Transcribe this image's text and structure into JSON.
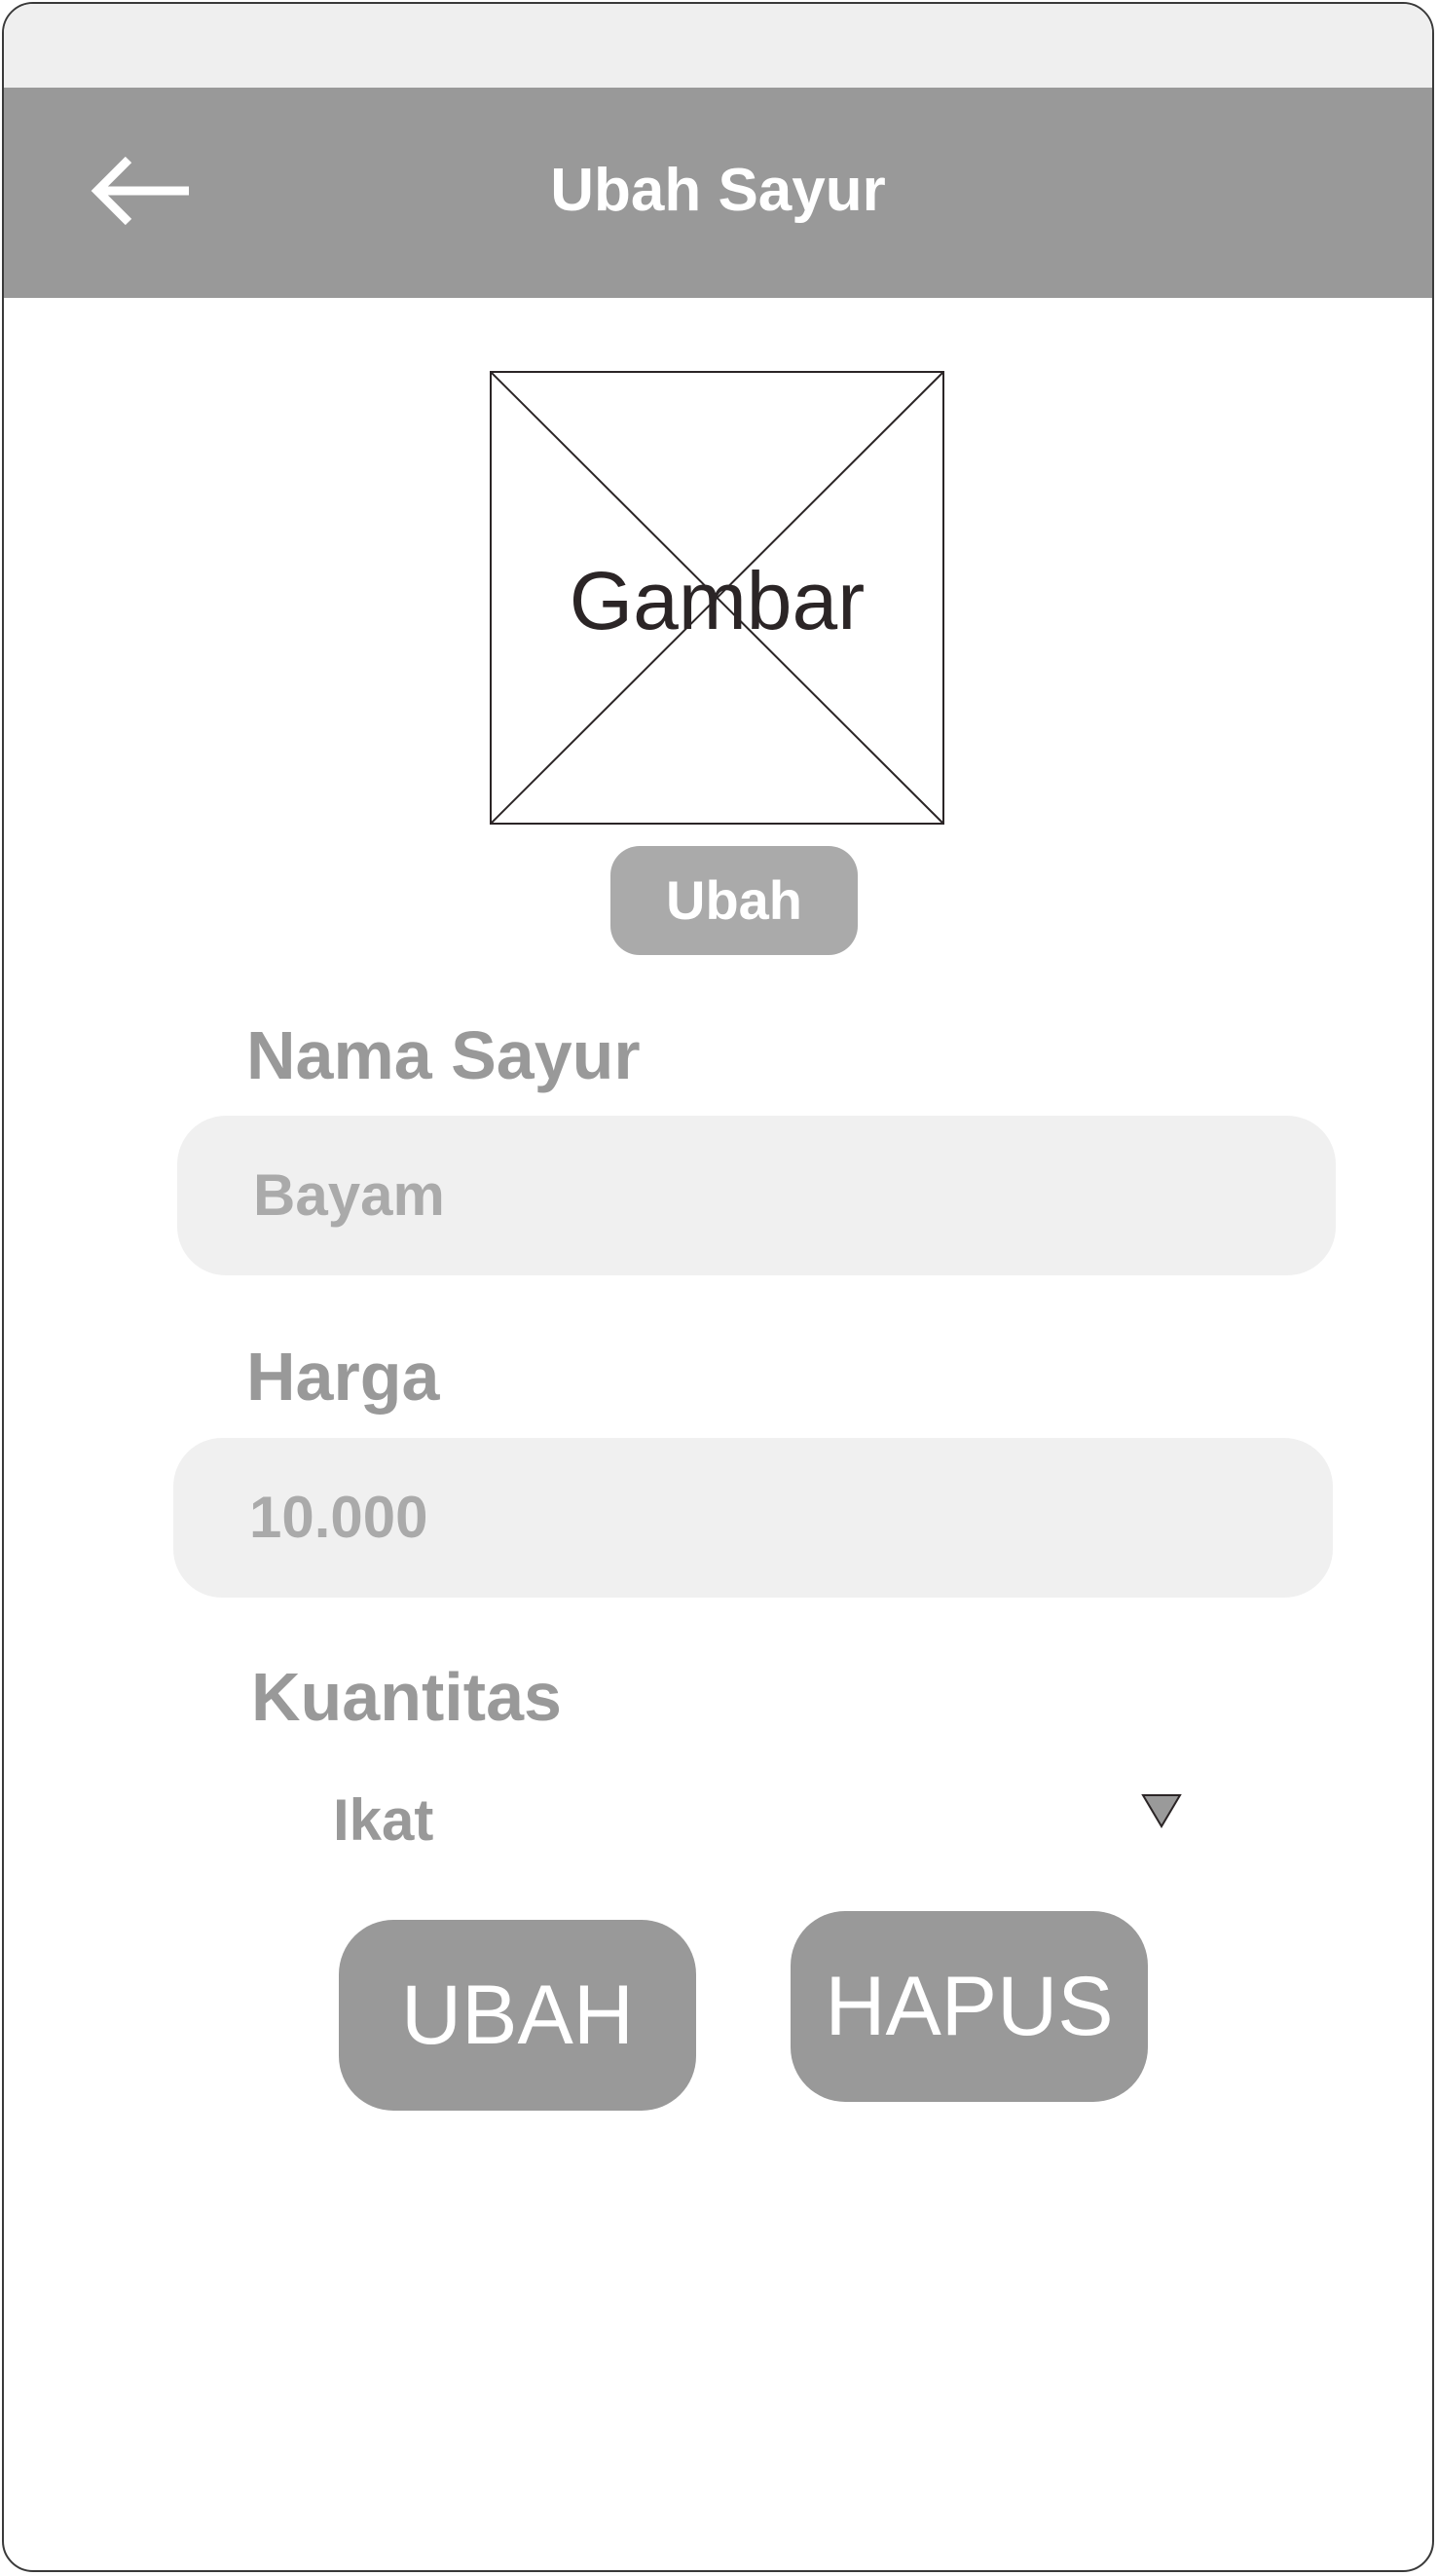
{
  "header": {
    "title": "Ubah Sayur",
    "back_icon": "arrow-left-icon"
  },
  "image": {
    "placeholder_label": "Gambar",
    "change_button_label": "Ubah"
  },
  "form": {
    "name": {
      "label": "Nama Sayur",
      "value": "Bayam"
    },
    "price": {
      "label": "Harga",
      "value": "10.000"
    },
    "quantity": {
      "label": "Kuantitas",
      "selected": "Ikat",
      "dropdown_icon": "triangle-down-icon"
    }
  },
  "actions": {
    "update_label": "UBAH",
    "delete_label": "HAPUS"
  },
  "colors": {
    "header_bg": "#999999",
    "status_bar_bg": "#efefef",
    "input_bg": "#f0f0f0",
    "button_bg": "#999999",
    "small_button_bg": "#aaaaaa",
    "label_text": "#999999"
  }
}
